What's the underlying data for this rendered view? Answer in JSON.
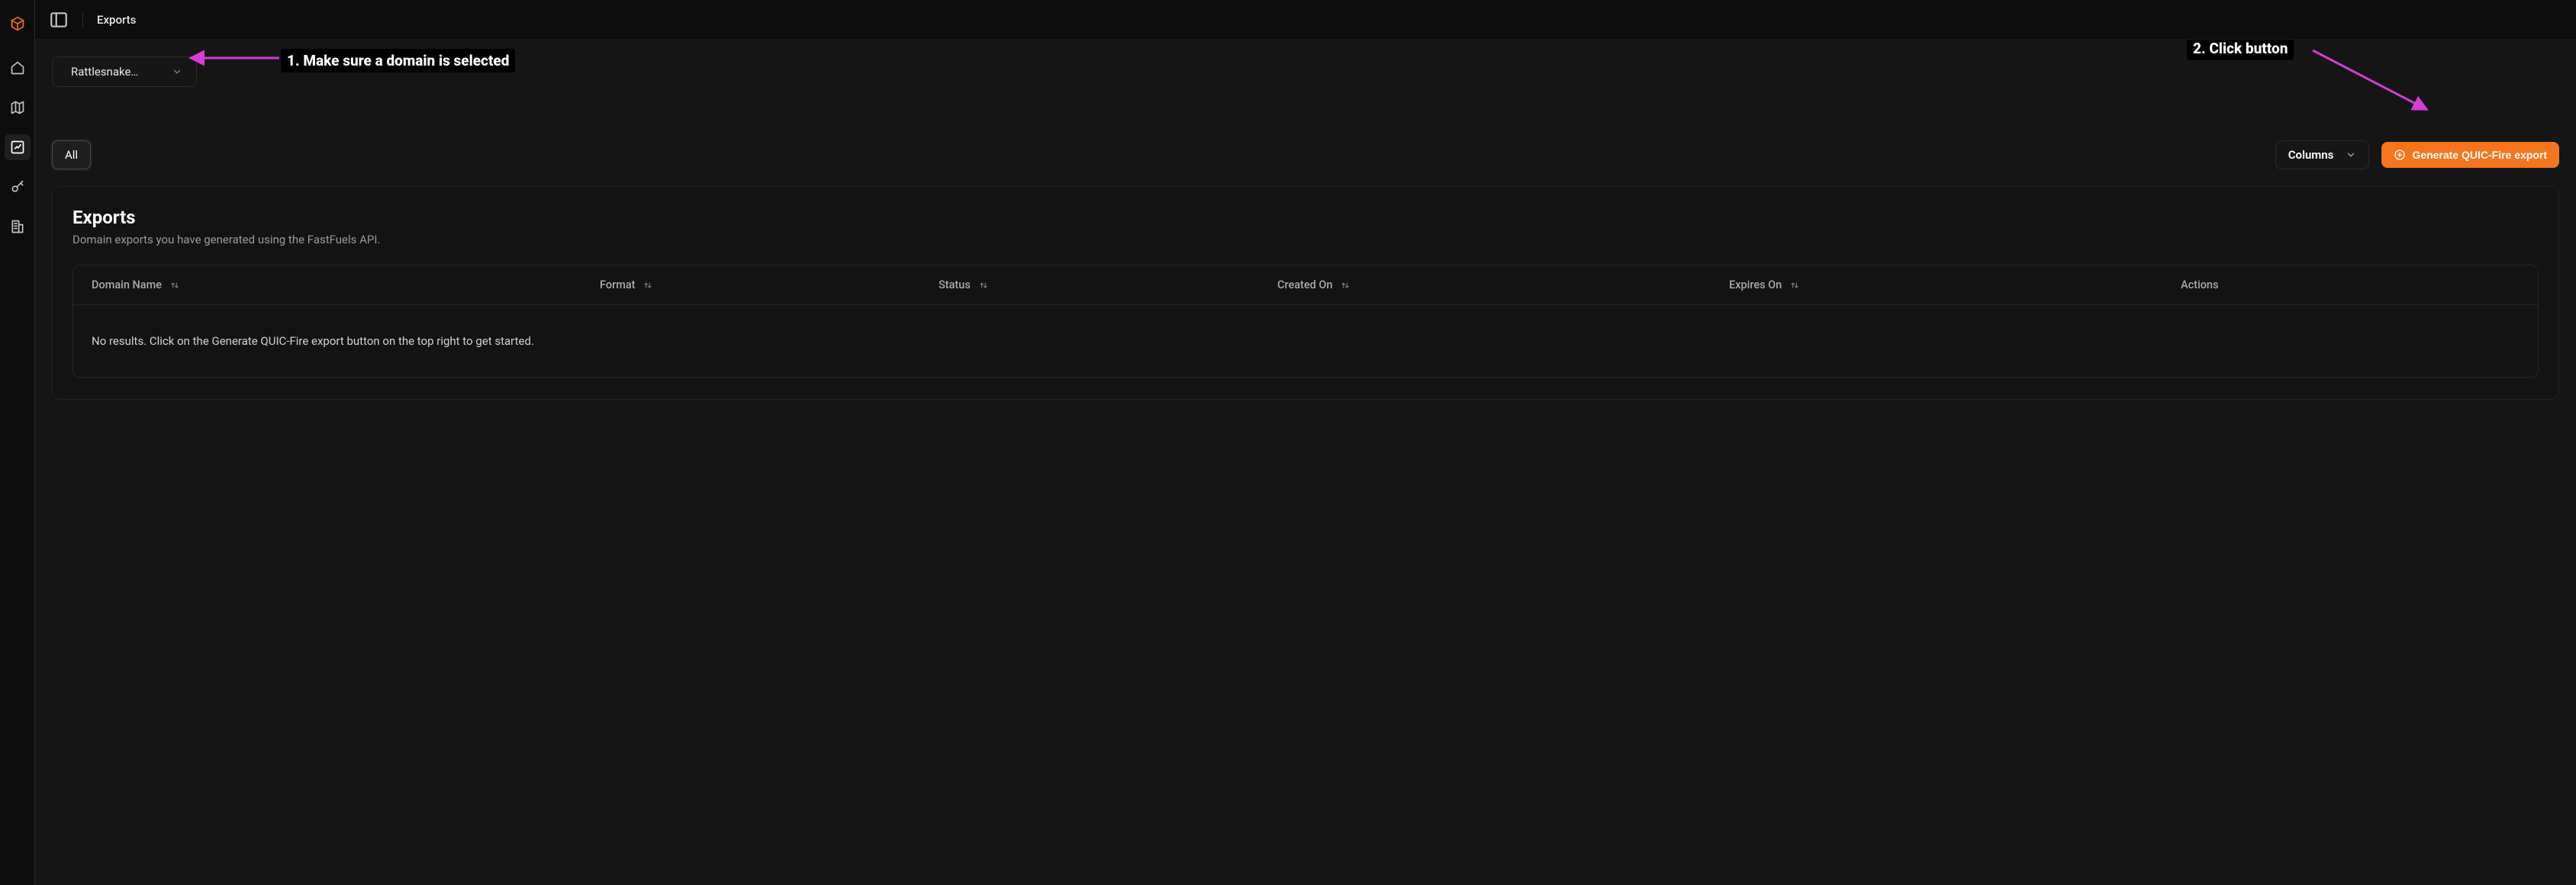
{
  "topbar": {
    "page_title": "Exports"
  },
  "domain_selector": {
    "selected": "Rattlesnake…"
  },
  "filters": {
    "all_label": "All"
  },
  "toolbar": {
    "columns_label": "Columns",
    "generate_label": "Generate QUIC-Fire export"
  },
  "card": {
    "title": "Exports",
    "subtitle": "Domain exports you have generated using the FastFuels API."
  },
  "table": {
    "columns": [
      {
        "label": "Domain Name",
        "sortable": true
      },
      {
        "label": "Format",
        "sortable": true
      },
      {
        "label": "Status",
        "sortable": true
      },
      {
        "label": "Created On",
        "sortable": true
      },
      {
        "label": "Expires On",
        "sortable": true
      },
      {
        "label": "Actions",
        "sortable": false
      }
    ],
    "empty_message": "No results. Click on the Generate QUIC-Fire export button on the top right to get started."
  },
  "annotations": {
    "step1": "1. Make sure a domain is selected",
    "step2": "2. Click button"
  }
}
